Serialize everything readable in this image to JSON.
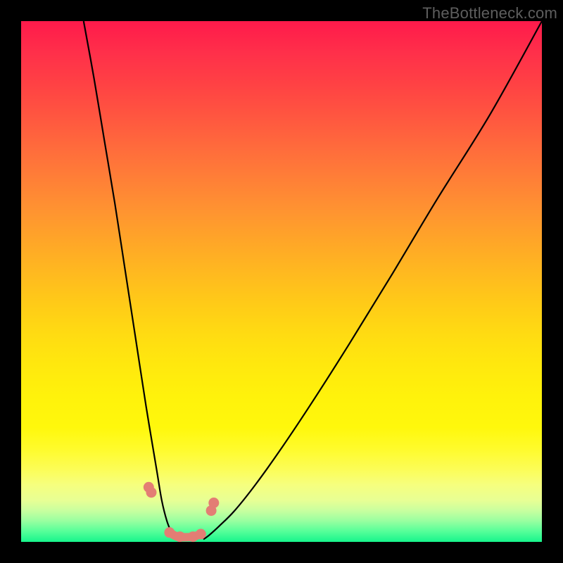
{
  "watermark": "TheBottleneck.com",
  "chart_data": {
    "type": "line",
    "title": "",
    "xlabel": "",
    "ylabel": "",
    "xlim": [
      0,
      100
    ],
    "ylim": [
      0,
      100
    ],
    "grid": false,
    "legend": false,
    "series": [
      {
        "name": "curve-left",
        "color": "#000000",
        "x": [
          12,
          14,
          16,
          18,
          20,
          22,
          24,
          26,
          27,
          28,
          29,
          29.5
        ],
        "values": [
          100,
          89,
          77,
          65,
          52,
          39,
          26,
          14,
          8,
          4,
          1.5,
          0.5
        ]
      },
      {
        "name": "curve-right",
        "color": "#000000",
        "x": [
          35,
          36,
          38,
          41,
          45,
          50,
          56,
          63,
          71,
          80,
          90,
          100
        ],
        "values": [
          0.5,
          1.2,
          3,
          6,
          11,
          18,
          27,
          38,
          51,
          66,
          82,
          100
        ]
      },
      {
        "name": "markers",
        "color": "#e37d74",
        "marker": "circle",
        "x": [
          24.5,
          25.0,
          28.5,
          30.5,
          33.0,
          34.5,
          36.5,
          37.0
        ],
        "values": [
          10.5,
          9.5,
          1.8,
          1.0,
          1.0,
          1.5,
          6.0,
          7.5
        ]
      },
      {
        "name": "bottom-arc",
        "color": "#e37d74",
        "x": [
          28.5,
          30.0,
          31.5,
          33.0,
          34.5
        ],
        "values": [
          1.8,
          1.0,
          0.9,
          1.0,
          1.5
        ]
      }
    ],
    "notes": "x and y are in 0–100 percent of the plot area; values are estimated from pixel positions (no axes/ticks are visible)."
  }
}
